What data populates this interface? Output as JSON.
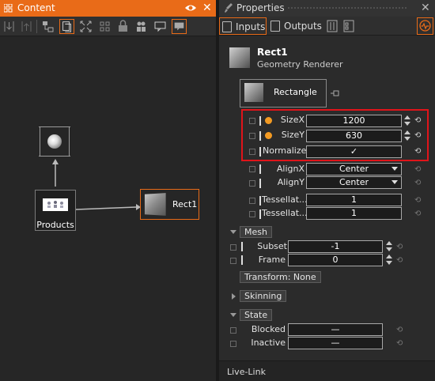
{
  "content_panel": {
    "title": "Content",
    "nodes": {
      "products": {
        "label": "Products"
      },
      "rect": {
        "label": "Rect1"
      }
    }
  },
  "properties_panel": {
    "title": "Properties",
    "tabs": {
      "inputs": "Inputs",
      "outputs": "Outputs"
    },
    "object": {
      "name": "Rect1",
      "type": "Geometry Renderer"
    },
    "shape": {
      "label": "Rectangle"
    },
    "params": {
      "size_x": {
        "label": "SizeX",
        "value": "1200"
      },
      "size_y": {
        "label": "SizeY",
        "value": "630"
      },
      "normalize": {
        "label": "Normalize",
        "value": "✓"
      },
      "align_x": {
        "label": "AlignX",
        "value": "Center"
      },
      "align_y": {
        "label": "AlignY",
        "value": "Center"
      },
      "tess_1": {
        "label": "Tessellat...",
        "value": "1"
      },
      "tess_2": {
        "label": "Tessellat...",
        "value": "1"
      }
    },
    "mesh": {
      "label": "Mesh",
      "subset": {
        "label": "Subset",
        "value": "-1"
      },
      "frame": {
        "label": "Frame",
        "value": "0"
      },
      "transform_label": "Transform:  None"
    },
    "skinning": {
      "label": "Skinning"
    },
    "state": {
      "label": "State",
      "blocked": {
        "label": "Blocked",
        "value": "—"
      },
      "inactive": {
        "label": "Inactive",
        "value": "—"
      }
    },
    "footer": "Live-Link"
  },
  "colors": {
    "accent": "#e96b18",
    "highlight_box": "#e0141a",
    "dot": "#f39a22"
  }
}
